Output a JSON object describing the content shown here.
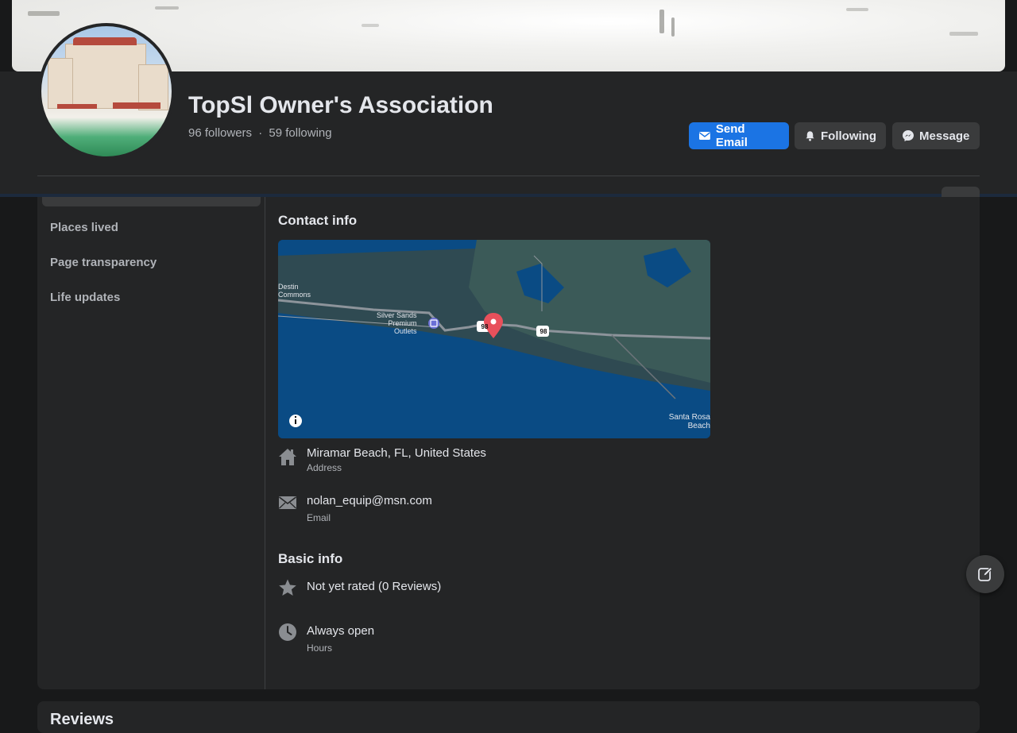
{
  "profile": {
    "name": "TopSl Owner's Association",
    "followers": "96 followers",
    "separator": "·",
    "following": "59 following"
  },
  "actions": {
    "send_email": "Send Email",
    "following": "Following",
    "message": "Message"
  },
  "colors": {
    "primary": "#1b74e4",
    "background": "#18191a",
    "card": "#242526",
    "map_pin": "#e8505b"
  },
  "sidebar": {
    "items": [
      {
        "label": "Places lived"
      },
      {
        "label": "Page transparency"
      },
      {
        "label": "Life updates"
      }
    ]
  },
  "contact": {
    "title": "Contact info",
    "map_labels": {
      "destin": "Destin",
      "commons": "Commons",
      "silver_sands_1": "Silver Sands",
      "silver_sands_2": "Premium",
      "silver_sands_3": "Outlets",
      "route_a": "98",
      "route_b": "98",
      "santa_rosa_1": "Santa Rosa",
      "santa_rosa_2": "Beach"
    },
    "address": {
      "value": "Miramar Beach, FL, United States",
      "label": "Address",
      "icon": "home-icon"
    },
    "email": {
      "value": "nolan_equip@msn.com",
      "label": "Email",
      "icon": "envelope-icon"
    }
  },
  "basic": {
    "title": "Basic info",
    "rating": {
      "value": "Not yet rated (0 Reviews)",
      "icon": "star-icon"
    },
    "hours": {
      "value": "Always open",
      "label": "Hours",
      "icon": "clock-icon"
    }
  },
  "reviews": {
    "title": "Reviews"
  }
}
